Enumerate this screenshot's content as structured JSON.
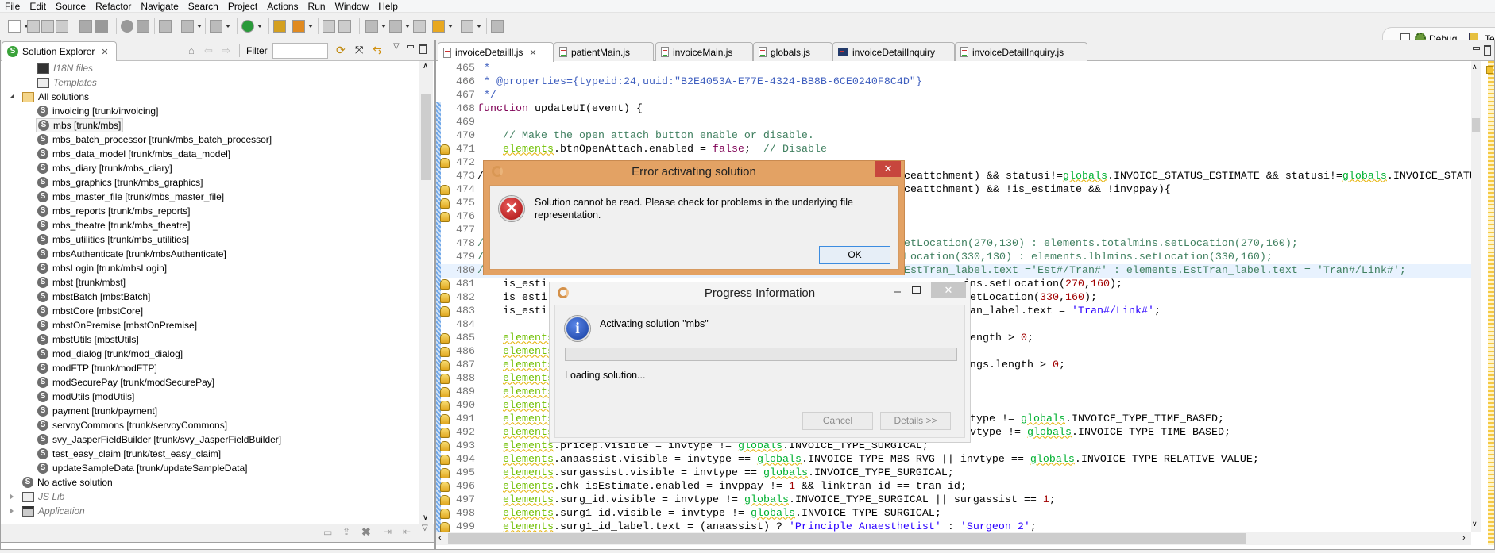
{
  "menu": [
    "File",
    "Edit",
    "Source",
    "Refactor",
    "Navigate",
    "Search",
    "Project",
    "Actions",
    "Run",
    "Window",
    "Help"
  ],
  "perspectives": [
    {
      "label": "Debug",
      "icon": "bug-icon"
    },
    {
      "label": "Te",
      "icon": "team-icon"
    }
  ],
  "explorer": {
    "title": "Solution Explorer",
    "filter_label": "Filter",
    "filter_value": "",
    "items": [
      {
        "label": "I18N files",
        "style": "italic",
        "level": 2,
        "icon": "i18n-icon"
      },
      {
        "label": "Templates",
        "style": "italic",
        "level": 2,
        "icon": "templates-icon"
      },
      {
        "label": "All solutions",
        "level": 1,
        "icon": "folder-open-icon",
        "expanded": true
      },
      {
        "label": "invoicing [trunk/invoicing]",
        "level": 2,
        "icon": "solution-icon"
      },
      {
        "label": "mbs [trunk/mbs]",
        "level": 2,
        "icon": "solution-icon",
        "selected": true
      },
      {
        "label": "mbs_batch_processor [trunk/mbs_batch_processor]",
        "level": 2,
        "icon": "solution-icon"
      },
      {
        "label": "mbs_data_model [trunk/mbs_data_model]",
        "level": 2,
        "icon": "solution-icon"
      },
      {
        "label": "mbs_diary [trunk/mbs_diary]",
        "level": 2,
        "icon": "solution-icon"
      },
      {
        "label": "mbs_graphics [trunk/mbs_graphics]",
        "level": 2,
        "icon": "solution-icon"
      },
      {
        "label": "mbs_master_file [trunk/mbs_master_file]",
        "level": 2,
        "icon": "solution-icon"
      },
      {
        "label": "mbs_reports [trunk/mbs_reports]",
        "level": 2,
        "icon": "solution-icon"
      },
      {
        "label": "mbs_theatre [trunk/mbs_theatre]",
        "level": 2,
        "icon": "solution-icon"
      },
      {
        "label": "mbs_utilities [trunk/mbs_utilities]",
        "level": 2,
        "icon": "solution-icon"
      },
      {
        "label": "mbsAuthenticate [trunk/mbsAuthenticate]",
        "level": 2,
        "icon": "solution-icon"
      },
      {
        "label": "mbsLogin [trunk/mbsLogin]",
        "level": 2,
        "icon": "solution-icon"
      },
      {
        "label": "mbst [trunk/mbst]",
        "level": 2,
        "icon": "solution-icon"
      },
      {
        "label": "mbstBatch [mbstBatch]",
        "level": 2,
        "icon": "solution-icon"
      },
      {
        "label": "mbstCore [mbstCore]",
        "level": 2,
        "icon": "solution-icon"
      },
      {
        "label": "mbstOnPremise [mbstOnPremise]",
        "level": 2,
        "icon": "solution-icon"
      },
      {
        "label": "mbstUtils [mbstUtils]",
        "level": 2,
        "icon": "solution-icon"
      },
      {
        "label": "mod_dialog [trunk/mod_dialog]",
        "level": 2,
        "icon": "solution-icon"
      },
      {
        "label": "modFTP [trunk/modFTP]",
        "level": 2,
        "icon": "solution-icon"
      },
      {
        "label": "modSecurePay [trunk/modSecurePay]",
        "level": 2,
        "icon": "solution-icon"
      },
      {
        "label": "modUtils [modUtils]",
        "level": 2,
        "icon": "solution-icon"
      },
      {
        "label": "payment [trunk/payment]",
        "level": 2,
        "icon": "solution-icon"
      },
      {
        "label": "servoyCommons [trunk/servoyCommons]",
        "level": 2,
        "icon": "solution-icon"
      },
      {
        "label": "svy_JasperFieldBuilder [trunk/svy_JasperFieldBuilder]",
        "level": 2,
        "icon": "solution-icon"
      },
      {
        "label": "test_easy_claim [trunk/test_easy_claim]",
        "level": 2,
        "icon": "solution-icon"
      },
      {
        "label": "updateSampleData [trunk/updateSampleData]",
        "level": 2,
        "icon": "solution-icon"
      },
      {
        "label": "No active solution",
        "level": 1,
        "icon": "solution-icon"
      },
      {
        "label": "JS Lib",
        "style": "italic",
        "level": 1,
        "icon": "library-icon",
        "expandable": true
      },
      {
        "label": "Application",
        "style": "italic",
        "level": 1,
        "icon": "application-icon",
        "expandable": true
      }
    ]
  },
  "editor": {
    "tabs": [
      {
        "label": "invoiceDetailll.js",
        "active": true,
        "icon": "js-file-icon"
      },
      {
        "label": "patientMain.js",
        "icon": "js-file-icon"
      },
      {
        "label": "invoiceMain.js",
        "icon": "js-file-icon"
      },
      {
        "label": "globals.js",
        "icon": "js-file-icon"
      },
      {
        "label": "invoiceDetailInquiry",
        "icon": "form-icon"
      },
      {
        "label": "invoiceDetailInquiry.js",
        "icon": "js-file-icon"
      }
    ],
    "lines": [
      {
        "n": "465",
        "text": " *"
      },
      {
        "n": "466",
        "text": " * @properties={typeid:24,uuid:\"B2E4053A-E77E-4324-BB8B-6CE0240F8C4D\"}"
      },
      {
        "n": "467",
        "text": " */"
      },
      {
        "n": "468",
        "text": "function updateUI(event) {"
      },
      {
        "n": "469",
        "text": ""
      },
      {
        "n": "470",
        "text": "    // Make the open attach button enable or disable."
      },
      {
        "n": "471",
        "text": "    elements.btnOpenAttach.enabled = false;  // Disable",
        "warn": true
      },
      {
        "n": "472",
        "text": "",
        "warn": true
      },
      {
        "n": "473",
        "text": "/",
        "tail": "ceattchment) && statusi!=globals.INVOICE_STATUS_ESTIMATE && statusi!=globals.INVOICE_STATU"
      },
      {
        "n": "474",
        "text": "",
        "tail": "ceattchment) && !is_estimate && !invppay){",
        "warn": true
      },
      {
        "n": "475",
        "text": "",
        "warn": true
      },
      {
        "n": "476",
        "text": "",
        "warn": true
      },
      {
        "n": "477",
        "text": ""
      },
      {
        "n": "478",
        "text": "/",
        "tail": "etLocation(270,130) : elements.totalmins.setLocation(270,160);",
        "comment": true
      },
      {
        "n": "479",
        "text": "/",
        "tail": "Location(330,130) : elements.lblmins.setLocation(330,160);",
        "comment": true
      },
      {
        "n": "480",
        "text": "/",
        "tail": "EstTran_label.text ='Est#/Tran#' : elements.EstTran_label.text = 'Tran#/Link#';",
        "comment": true,
        "current": true
      },
      {
        "n": "481",
        "text": "    is_esti",
        "tail": "ins.setLocation(270,160);",
        "warn": true
      },
      {
        "n": "482",
        "text": "    is_esti",
        "tail": "setLocation(330,160);",
        "warn": true
      },
      {
        "n": "483",
        "text": "    is_esti",
        "tail": "ran_label.text = 'Tran#/Link#';",
        "warn": true
      },
      {
        "n": "484",
        "text": ""
      },
      {
        "n": "485",
        "text": "    elements",
        "tail": "length > 0;",
        "warn": true
      },
      {
        "n": "486",
        "text": "    elements",
        "warn": true
      },
      {
        "n": "487",
        "text": "    elements",
        "tail": "ings.length > 0;",
        "warn": true
      },
      {
        "n": "488",
        "text": "    elements",
        "warn": true
      },
      {
        "n": "489",
        "text": "    elements",
        "warn": true
      },
      {
        "n": "490",
        "text": "    elements",
        "warn": true
      },
      {
        "n": "491",
        "text": "    elements",
        "tail": "ntype != globals.INVOICE_TYPE_TIME_BASED;",
        "warn": true
      },
      {
        "n": "492",
        "text": "    elements",
        "tail": "nvtype != globals.INVOICE_TYPE_TIME_BASED;",
        "warn": true
      },
      {
        "n": "493",
        "text": "    elements.pricep.visible = invtype != globals.INVOICE_TYPE_SURGICAL;",
        "warn": true
      },
      {
        "n": "494",
        "text": "    elements.anaassist.visible = invtype == globals.INVOICE_TYPE_MBS_RVG || invtype == globals.INVOICE_TYPE_RELATIVE_VALUE;",
        "warn": true
      },
      {
        "n": "495",
        "text": "    elements.surgassist.visible = invtype == globals.INVOICE_TYPE_SURGICAL;",
        "warn": true
      },
      {
        "n": "496",
        "text": "    elements.chk_isEstimate.enabled = invppay != 1 && linktran_id == tran_id;",
        "warn": true
      },
      {
        "n": "497",
        "text": "    elements.surg_id.visible = invtype != globals.INVOICE_TYPE_SURGICAL || surgassist == 1;",
        "warn": true
      },
      {
        "n": "498",
        "text": "    elements.surg1_id.visible = invtype != globals.INVOICE_TYPE_SURGICAL;",
        "warn": true
      },
      {
        "n": "499",
        "text": "    elements.surg1_id_label.text = (anaassist) ? 'Principle Anaesthetist' : 'Surgeon 2';",
        "warn": true
      }
    ]
  },
  "error_dialog": {
    "title": "Error activating solution",
    "message_line1": "Solution cannot be read. Please check for problems in the underlying file",
    "message_line2": "representation.",
    "ok_label": "OK",
    "close_glyph": "✕",
    "title_bar_color": "#e3a264"
  },
  "progress_dialog": {
    "title": "Progress Information",
    "message": "Activating solution \"mbs\"",
    "status": "Loading solution...",
    "progress_percent": 0,
    "cancel_label": "Cancel",
    "details_label": "Details >>",
    "close_glyph": "✕"
  }
}
